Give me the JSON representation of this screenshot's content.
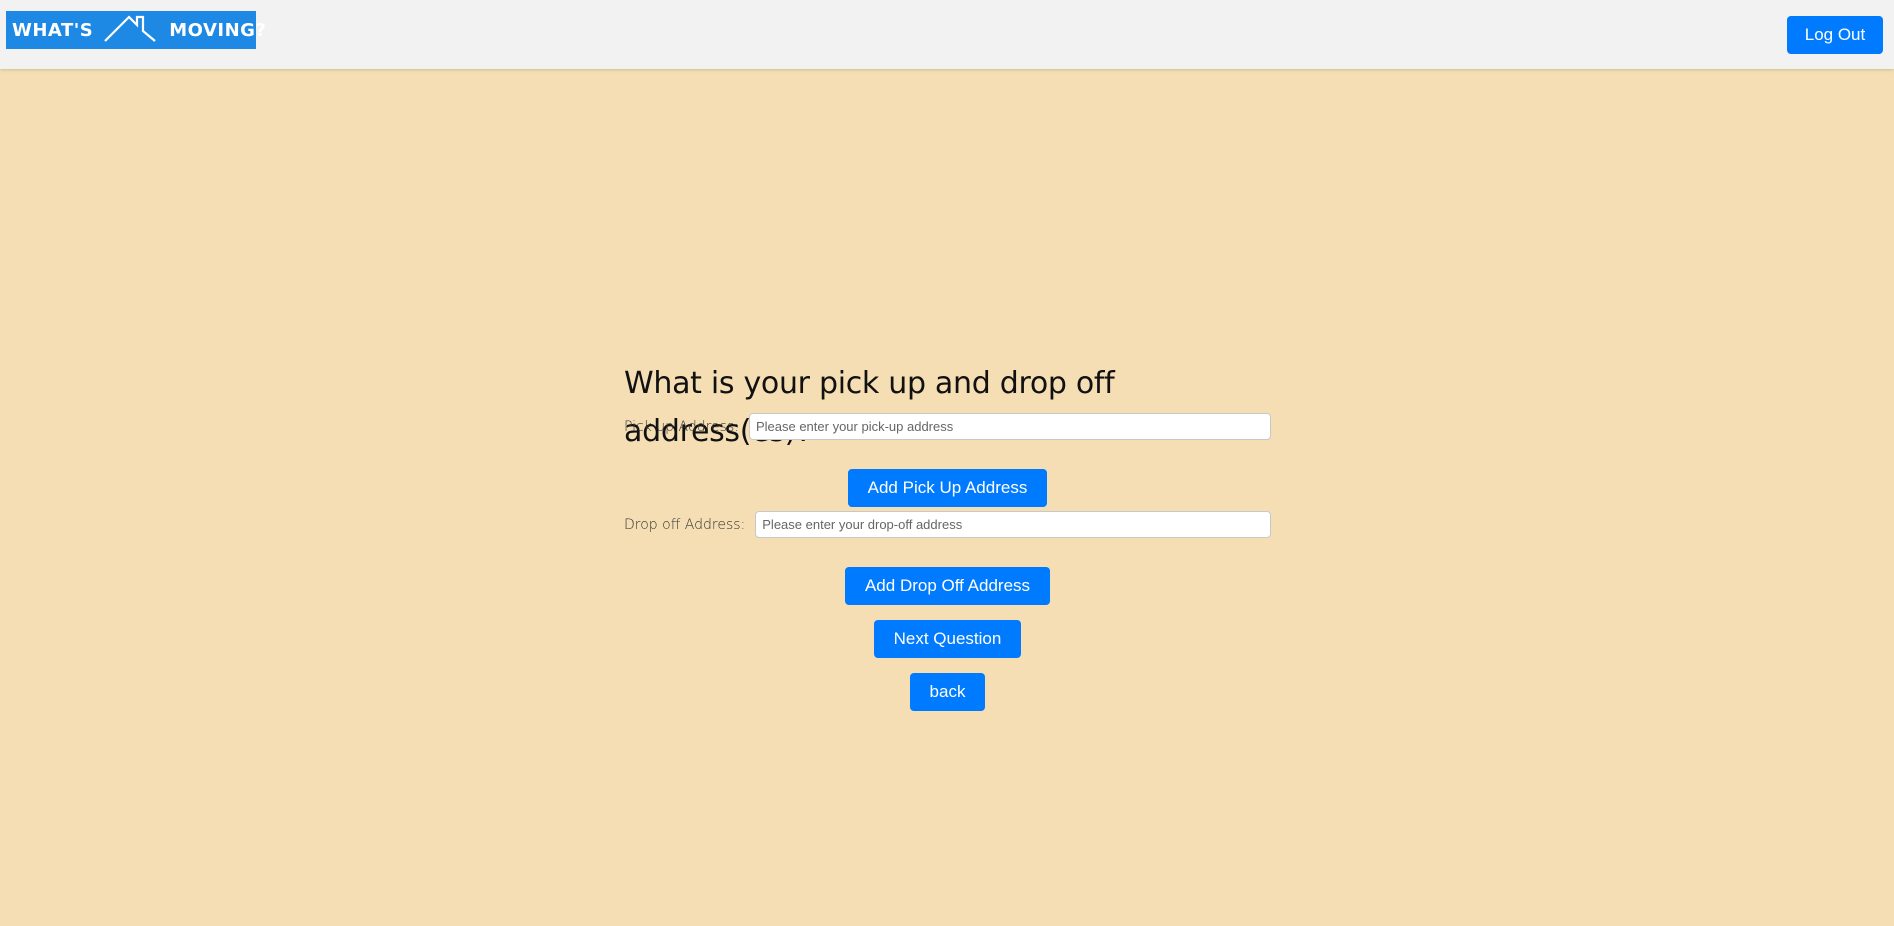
{
  "header": {
    "logo_left": "WHAT'S",
    "logo_right": "MOVING?",
    "logout_label": "Log Out"
  },
  "form": {
    "question": "What is your pick up and drop off address(es)?",
    "pickup_label": "Pick up Address:",
    "pickup_placeholder": "Please enter your pick-up address",
    "pickup_value": "",
    "add_pickup_label": "Add Pick Up Address",
    "dropoff_label": "Drop off Address:",
    "dropoff_placeholder": "Please enter your drop-off address",
    "dropoff_value": "",
    "add_dropoff_label": "Add Drop Off Address",
    "next_label": "Next Question",
    "back_label": "back"
  },
  "colors": {
    "background": "#f5deb3",
    "navbar": "#f2f2f2",
    "logo_bg": "#1e88e5",
    "button": "#007bff"
  },
  "icons": {
    "logo": "house-roof-icon"
  }
}
